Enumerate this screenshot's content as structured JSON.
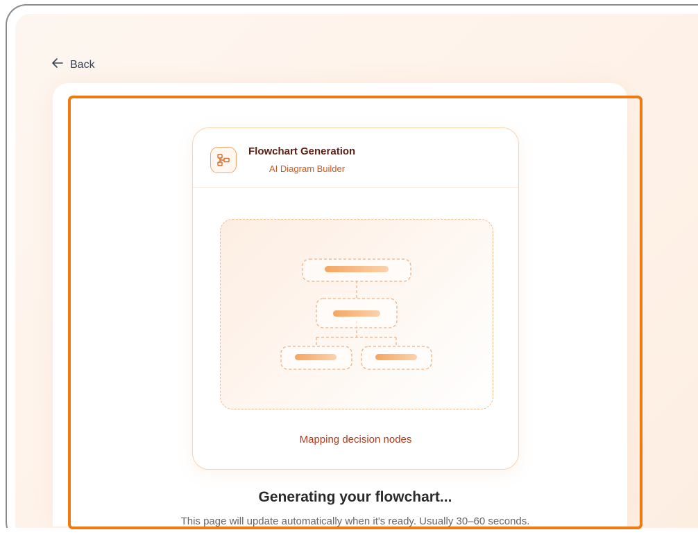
{
  "nav": {
    "back_label": "Back"
  },
  "card": {
    "title": "Flowchart Generation",
    "subtitle": "AI Diagram Builder",
    "caption": "Mapping decision nodes"
  },
  "status": {
    "heading": "Generating your flowchart...",
    "description": "This page will update automatically when it's ready. Usually 30–60 seconds."
  },
  "icons": {
    "back": "arrow-left-icon",
    "app": "flowchart-icon"
  },
  "colors": {
    "accent": "#f07a12",
    "card_border": "#f8d3b0",
    "title": "#5a1f14",
    "subtitle": "#d3581b",
    "caption": "#b23a1a",
    "heading": "#2b2b2b"
  }
}
